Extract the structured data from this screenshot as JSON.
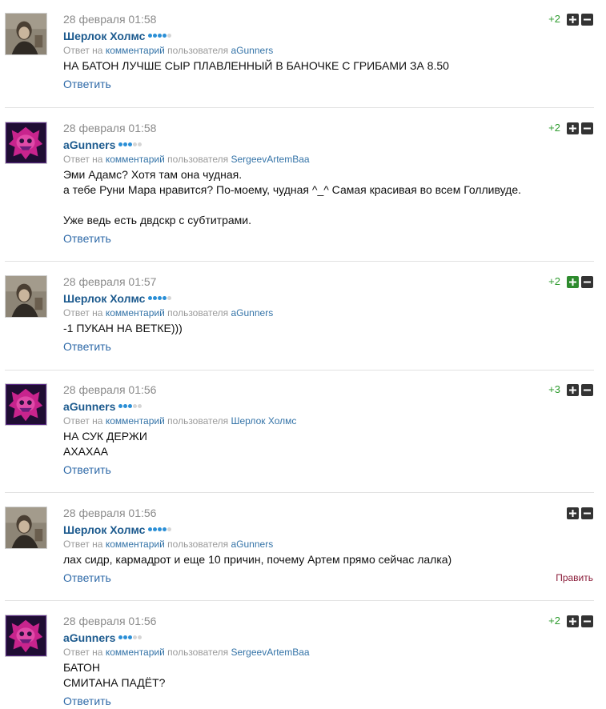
{
  "labels": {
    "reply_prefix": "Ответ на",
    "reply_link": "комментарий",
    "reply_user_prefix": "пользователя",
    "answer": "Ответить",
    "edit": "Править"
  },
  "colors": {
    "link": "#2f6aa8",
    "author": "#1c5a8e",
    "score": "#2e9b2e",
    "edit": "#8b1d3a"
  },
  "comments": [
    {
      "date": "28 февраля 01:58",
      "author": "Шерлок Холмс",
      "avatar": "avatar-photo",
      "dots_on": 4,
      "reply_user": "aGunners",
      "lines": [
        "НА БАТОН ЛУЧШЕ СЫР ПЛАВЛЕННЫЙ В БАНОЧКЕ С ГРИБАМИ ЗА 8.50"
      ],
      "score": "+2",
      "plus_active": false,
      "edit": false
    },
    {
      "date": "28 февраля 01:58",
      "author": "aGunners",
      "avatar": "avatar-pink",
      "dots_on": 3,
      "reply_user": "SergeevArtemBaa",
      "lines": [
        "Эми Адамс? Хотя там она чудная.",
        "а тебе Руни Мара нравится? По-моему, чудная ^_^ Самая красивая во всем Голливуде.",
        "",
        "Уже ведь есть двдскр с субтитрами."
      ],
      "score": "+2",
      "plus_active": false,
      "edit": false
    },
    {
      "date": "28 февраля 01:57",
      "author": "Шерлок Холмс",
      "avatar": "avatar-photo",
      "dots_on": 4,
      "reply_user": "aGunners",
      "lines": [
        "-1 ПУКАН НА ВЕТКЕ)))"
      ],
      "score": "+2",
      "plus_active": true,
      "edit": false
    },
    {
      "date": "28 февраля 01:56",
      "author": "aGunners",
      "avatar": "avatar-pink",
      "dots_on": 3,
      "reply_user": "Шерлок Холмс",
      "lines": [
        "НА СУК ДЕРЖИ",
        "АХАХАА"
      ],
      "score": "+3",
      "plus_active": false,
      "edit": false
    },
    {
      "date": "28 февраля 01:56",
      "author": "Шерлок Холмс",
      "avatar": "avatar-photo",
      "dots_on": 4,
      "reply_user": "aGunners",
      "lines": [
        "лах сидр, кармадрот и еще 10 причин, почему Артем прямо сейчас лалка)"
      ],
      "score": "",
      "plus_active": false,
      "edit": true
    },
    {
      "date": "28 февраля 01:56",
      "author": "aGunners",
      "avatar": "avatar-pink",
      "dots_on": 3,
      "reply_user": "SergeevArtemBaa",
      "lines": [
        "БАТОН",
        "СМИТАНА ПАДЁТ?"
      ],
      "score": "+2",
      "plus_active": false,
      "edit": false
    }
  ]
}
